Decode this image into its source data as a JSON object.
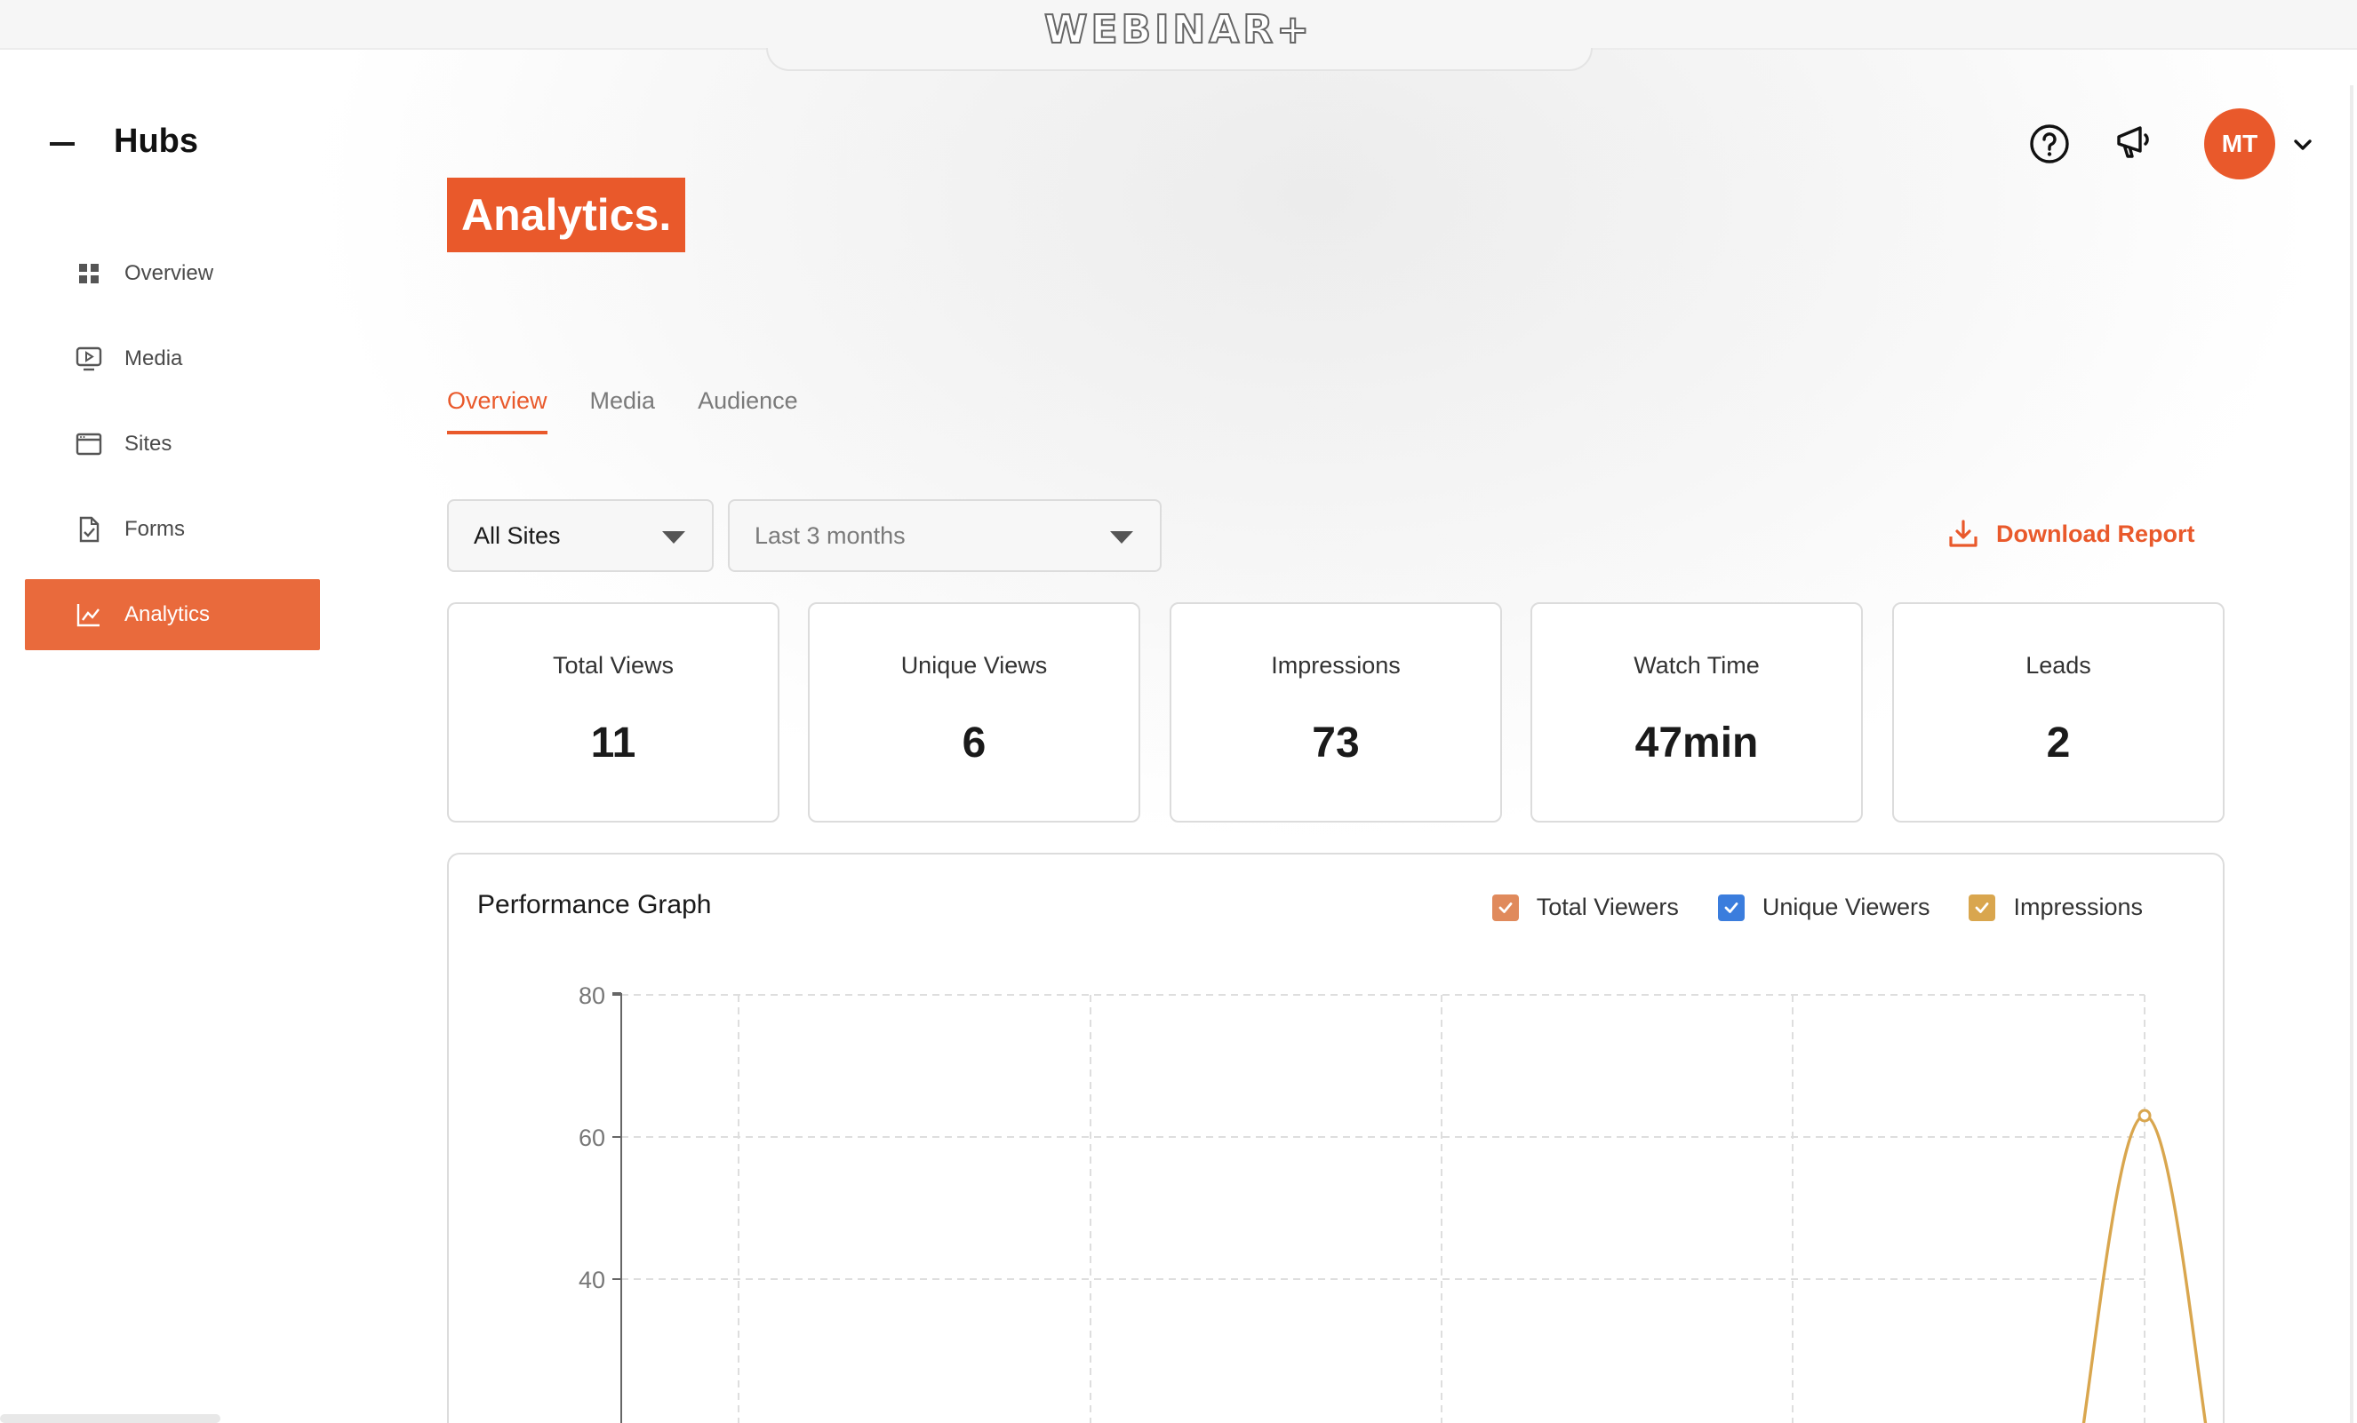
{
  "app": {
    "logo": "WEBINAR+"
  },
  "sidebar": {
    "title": "Hubs",
    "items": [
      {
        "label": "Overview",
        "icon": "grid-icon"
      },
      {
        "label": "Media",
        "icon": "media-icon"
      },
      {
        "label": "Sites",
        "icon": "browser-icon"
      },
      {
        "label": "Forms",
        "icon": "form-icon"
      },
      {
        "label": "Analytics",
        "icon": "chart-icon",
        "active": true
      }
    ]
  },
  "header": {
    "avatar_initials": "MT"
  },
  "page": {
    "title": "Analytics."
  },
  "tabs": [
    {
      "label": "Overview",
      "active": true
    },
    {
      "label": "Media"
    },
    {
      "label": "Audience"
    }
  ],
  "filters": {
    "site": "All Sites",
    "range": "Last 3 months",
    "download_label": "Download Report"
  },
  "stats": [
    {
      "label": "Total Views",
      "value": "11"
    },
    {
      "label": "Unique Views",
      "value": "6"
    },
    {
      "label": "Impressions",
      "value": "73"
    },
    {
      "label": "Watch Time",
      "value": "47min"
    },
    {
      "label": "Leads",
      "value": "2"
    }
  ],
  "colors": {
    "accent": "#e9592b",
    "total_viewers": "#e08a5c",
    "unique_viewers": "#3b7ddd",
    "impressions": "#d9a64e"
  },
  "graph": {
    "title": "Performance Graph",
    "legend": [
      "Total Viewers",
      "Unique Viewers",
      "Impressions"
    ]
  },
  "chart_data": {
    "type": "line",
    "title": "Performance Graph",
    "yticks": [
      40,
      60,
      80
    ],
    "ylim": [
      0,
      80
    ],
    "grid": true,
    "series": [
      {
        "name": "Impressions",
        "values": [
          {
            "x": 4,
            "y": 63
          }
        ]
      }
    ]
  }
}
